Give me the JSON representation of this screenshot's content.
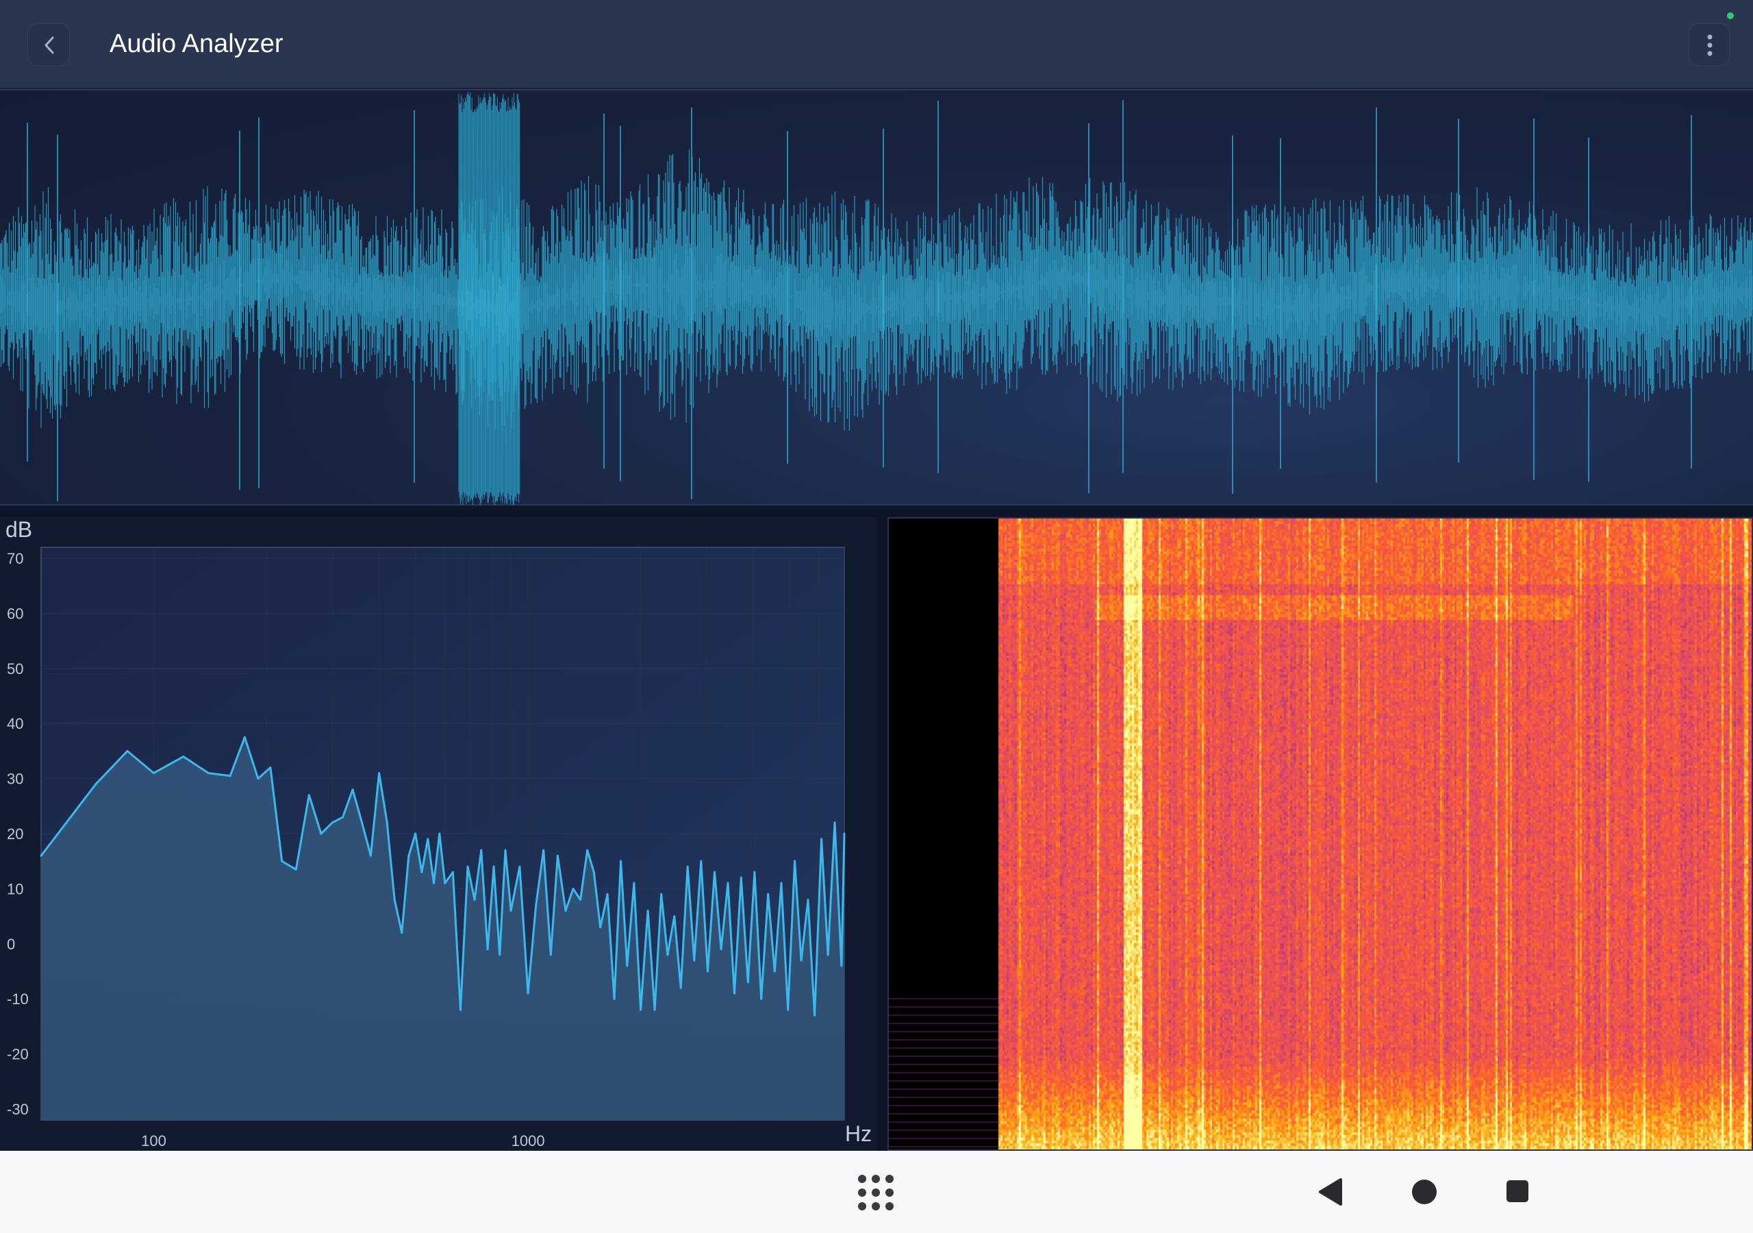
{
  "header": {
    "title": "Audio Analyzer",
    "back_icon": "chevron-left-icon",
    "menu_icon": "more-vertical-icon",
    "status_indicator_color": "#2ecc71"
  },
  "colors": {
    "background": "#0d1526",
    "app_bar": "#2a3550",
    "waveform": "#2aa2c8",
    "spectrum_line": "#3cb9ec",
    "spectrum_fill": "#2f5175"
  },
  "spectrum": {
    "y_unit": "dB",
    "x_unit": "Hz"
  },
  "chart_data": [
    {
      "type": "area",
      "name": "frequency-spectrum",
      "ylabel": "dB",
      "xlabel": "Hz",
      "x_scale": "log",
      "xlim": [
        50,
        7000
      ],
      "ylim": [
        -32,
        72
      ],
      "yticks": [
        "70",
        "60",
        "50",
        "40",
        "30",
        "20",
        "10",
        "0",
        "-10",
        "-20",
        "-30"
      ],
      "xticks": [
        "100",
        "1000"
      ],
      "grid": true,
      "x": [
        50,
        70,
        85,
        100,
        120,
        140,
        160,
        175,
        190,
        205,
        220,
        240,
        260,
        280,
        300,
        320,
        340,
        360,
        380,
        400,
        420,
        440,
        460,
        480,
        500,
        520,
        540,
        560,
        580,
        600,
        630,
        660,
        690,
        720,
        750,
        780,
        810,
        840,
        870,
        900,
        950,
        1000,
        1050,
        1100,
        1150,
        1200,
        1260,
        1320,
        1380,
        1440,
        1500,
        1560,
        1630,
        1700,
        1770,
        1840,
        1920,
        2000,
        2090,
        2180,
        2270,
        2360,
        2460,
        2560,
        2670,
        2780,
        2900,
        3020,
        3150,
        3280,
        3420,
        3560,
        3710,
        3870,
        4030,
        4200,
        4380,
        4560,
        4750,
        4950,
        5160,
        5370,
        5600,
        5830,
        6080,
        6330,
        6600,
        6880,
        7000
      ],
      "values": [
        16,
        29,
        35,
        31,
        34,
        31,
        30.5,
        37.5,
        30,
        32,
        15,
        13.5,
        27,
        20,
        22,
        23,
        28,
        22,
        16,
        31,
        22,
        8,
        2,
        16,
        20,
        13,
        19,
        11,
        20,
        11,
        13,
        -12,
        14,
        8,
        17,
        -1,
        14,
        -2,
        17,
        6,
        14,
        -9,
        7,
        17,
        -2,
        16,
        6,
        10,
        8,
        17,
        13,
        3,
        9,
        -10,
        15,
        -4,
        11,
        -12,
        6,
        -12,
        9,
        -2,
        5,
        -8,
        14,
        -3,
        15,
        -5,
        13,
        -1,
        11,
        -9,
        12,
        -7,
        13,
        -10,
        9,
        -5,
        11,
        -12,
        15,
        -3,
        8,
        -13,
        19,
        -2,
        22,
        -4,
        20
      ]
    },
    {
      "type": "heatmap",
      "name": "spectrogram",
      "colormap": [
        "#000000",
        "#3b0f70",
        "#8c2981",
        "#de4968",
        "#fe5f2e",
        "#fcae12",
        "#fcffa4"
      ]
    }
  ]
}
